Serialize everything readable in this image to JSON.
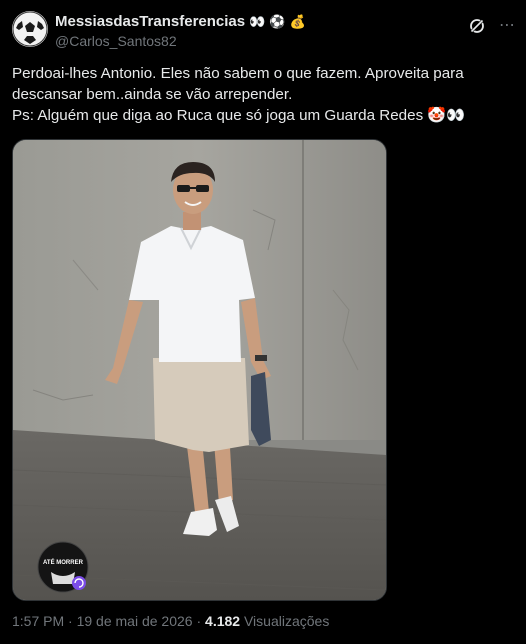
{
  "author": {
    "display_name": "MessiasdasTransferencias",
    "handle": "@Carlos_Santos82",
    "name_emojis": [
      "👀",
      "⚽",
      "💰"
    ]
  },
  "tweet": {
    "line1": "Perdoai-lhes  Antonio. Eles não sabem o que fazem. Aproveita para descansar bem..ainda se vão arrepender.",
    "line2": "Ps: Alguém que diga ao Ruca que só joga um Guarda Redes 🤡👀"
  },
  "media": {
    "watermark_text": "ATÉ MORRER"
  },
  "meta": {
    "time": "1:57 PM",
    "separator": "·",
    "date": "19 de mai de 2026",
    "views_count": "4.182",
    "views_label": "Visualizações"
  },
  "icons": {
    "grok": "grok-icon",
    "more": "more-icon"
  }
}
